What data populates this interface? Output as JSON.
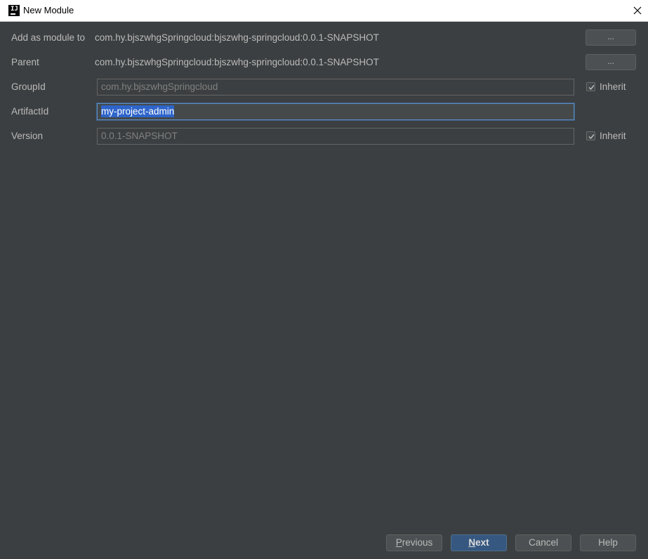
{
  "window": {
    "title": "New Module",
    "app_icon_text": "IJ"
  },
  "form": {
    "add_as_module": {
      "label": "Add as module to",
      "value": "com.hy.bjszwhgSpringcloud:bjszwhg-springcloud:0.0.1-SNAPSHOT",
      "browse_label": "..."
    },
    "parent": {
      "label": "Parent",
      "value": "com.hy.bjszwhgSpringcloud:bjszwhg-springcloud:0.0.1-SNAPSHOT",
      "browse_label": "..."
    },
    "group_id": {
      "label": "GroupId",
      "value": "com.hy.bjszwhgSpringcloud",
      "inherit_label": "Inherit",
      "inherit_checked": true
    },
    "artifact_id": {
      "label": "ArtifactId",
      "value": "my-project-admin"
    },
    "version": {
      "label": "Version",
      "value": "0.0.1-SNAPSHOT",
      "inherit_label": "Inherit",
      "inherit_checked": true
    }
  },
  "footer": {
    "previous": {
      "mnemonic": "P",
      "rest": "revious"
    },
    "next": {
      "mnemonic": "N",
      "rest": "ext"
    },
    "cancel": "Cancel",
    "help": "Help"
  },
  "colors": {
    "background": "#3c3f41",
    "text": "#bbbbbb",
    "primary_button": "#365880",
    "selection": "#2f65ca",
    "focus_border": "#5a8ac2"
  }
}
